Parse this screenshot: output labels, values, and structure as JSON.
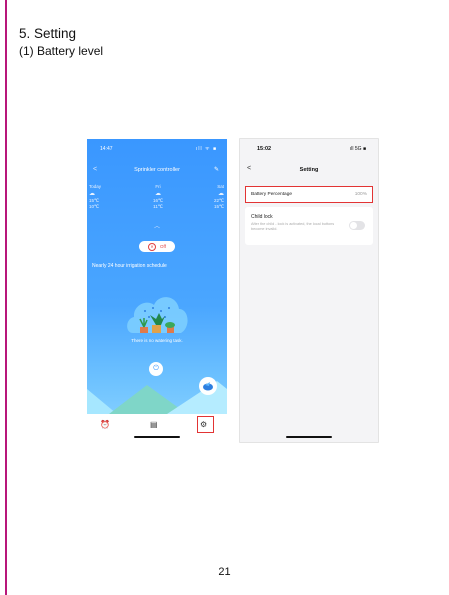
{
  "doc": {
    "section_title": "5. Setting",
    "section_subtitle": "(1) Battery level",
    "page_number": "21"
  },
  "colors": {
    "accent_rule": "#b8177a",
    "highlight": "#e23434",
    "app_blue": "#3a97ff"
  },
  "phone1": {
    "status_time": "14:47",
    "status_icons": "ıll ᯤ ■",
    "title": "Sprinkler controller",
    "weather": [
      {
        "day": "Today",
        "high": "15℃",
        "low": "10℃"
      },
      {
        "day": "Fri",
        "high": "16℃",
        "low": "11℃"
      },
      {
        "day": "Sat",
        "high": "22℃",
        "low": "15℃"
      }
    ],
    "off_label": "Off",
    "schedule_label": "Nearly 24 hour irrigation schedule",
    "no_watering": "There is no watering task."
  },
  "phone2": {
    "status_time": "15:02",
    "status_icons": "ıll 5G ■",
    "title": "Setting",
    "battery_label": "Battery Percentage",
    "battery_value": "100%",
    "child_lock_title": "Child lock",
    "child_lock_desc": "After the child - lock is activated, the local buttons become invalid."
  }
}
